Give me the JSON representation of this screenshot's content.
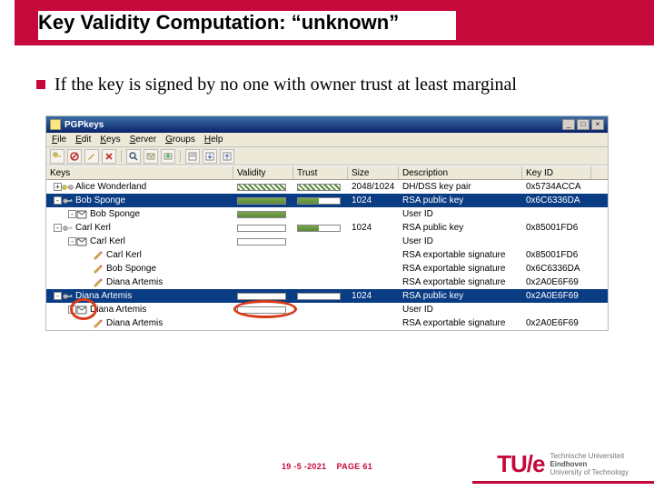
{
  "header": {
    "title": "Key Validity Computation: “unknown”"
  },
  "bullet": {
    "text": "If the key is signed by no one with owner trust at least marginal"
  },
  "window": {
    "title": "PGPkeys",
    "min": "_",
    "max": "□",
    "close": "×",
    "menus": [
      "File",
      "Edit",
      "Keys",
      "Server",
      "Groups",
      "Help"
    ]
  },
  "columns": {
    "keys": "Keys",
    "validity": "Validity",
    "trust": "Trust",
    "size": "Size",
    "description": "Description",
    "keyid": "Key ID"
  },
  "rows": [
    {
      "exp": "+",
      "indent": 0,
      "icon": "keypair",
      "name": "Alice Wonderland <alice@test.o...",
      "val": "hatch",
      "trust": "hatch",
      "size": "2048/1024",
      "desc": "DH/DSS key pair",
      "id": "0x5734ACCA",
      "sel": false
    },
    {
      "exp": "-",
      "indent": 0,
      "icon": "key",
      "name": "Bob Sponge <sponge@test.org>",
      "val": "fill",
      "trust": "half",
      "size": "1024",
      "desc": "RSA public key",
      "id": "0x6C6336DA",
      "sel": true
    },
    {
      "exp": "-",
      "indent": 1,
      "icon": "uid",
      "name": "Bob Sponge <sponge@test.org>",
      "val": "fill",
      "trust": "",
      "size": "",
      "desc": "User ID",
      "id": "",
      "sel": false
    },
    {
      "exp": "-",
      "indent": 0,
      "icon": "key",
      "name": "Carl Kerl <kerl@test.org>",
      "val": "empty",
      "trust": "half",
      "size": "1024",
      "desc": "RSA public key",
      "id": "0x85001FD6",
      "sel": false
    },
    {
      "exp": "-",
      "indent": 1,
      "icon": "uid",
      "name": "Carl Kerl <kerl@test.org>",
      "val": "empty",
      "trust": "",
      "size": "",
      "desc": "User ID",
      "id": "",
      "sel": false
    },
    {
      "exp": "",
      "indent": 2,
      "icon": "sig",
      "name": "Carl Kerl <kerl@test.org>",
      "val": "",
      "trust": "",
      "size": "",
      "desc": "RSA exportable signature",
      "id": "0x85001FD6",
      "sel": false
    },
    {
      "exp": "",
      "indent": 2,
      "icon": "sig",
      "name": "Bob Sponge <sponge@test.o...",
      "val": "",
      "trust": "",
      "size": "",
      "desc": "RSA exportable signature",
      "id": "0x6C6336DA",
      "sel": false
    },
    {
      "exp": "",
      "indent": 2,
      "icon": "sig",
      "name": "Diana Artemis <artemis@test....",
      "val": "",
      "trust": "",
      "size": "",
      "desc": "RSA exportable signature",
      "id": "0x2A0E6F69",
      "sel": false
    },
    {
      "exp": "-",
      "indent": 0,
      "icon": "key",
      "name": "Diana Artemis <artemis@test.org>",
      "val": "empty",
      "trust": "empty",
      "size": "1024",
      "desc": "RSA public key",
      "id": "0x2A0E6F69",
      "sel": true
    },
    {
      "exp": "-",
      "indent": 1,
      "icon": "uid",
      "name": "Diana Artemis <artemis@test.org>",
      "val": "empty",
      "trust": "",
      "size": "",
      "desc": "User ID",
      "id": "",
      "sel": false
    },
    {
      "exp": "",
      "indent": 2,
      "icon": "sig",
      "name": "Diana Artemis <artemis@test....",
      "val": "",
      "trust": "",
      "size": "",
      "desc": "RSA exportable signature",
      "id": "0x2A0E6F69",
      "sel": false
    }
  ],
  "footer": {
    "date": "19 -5 -2021",
    "page": "PAGE 61"
  },
  "logo": {
    "mark": "TU",
    "slash": "/e",
    "l1": "Technische Universiteit",
    "l2": "Eindhoven",
    "l3": "University of Technology"
  }
}
